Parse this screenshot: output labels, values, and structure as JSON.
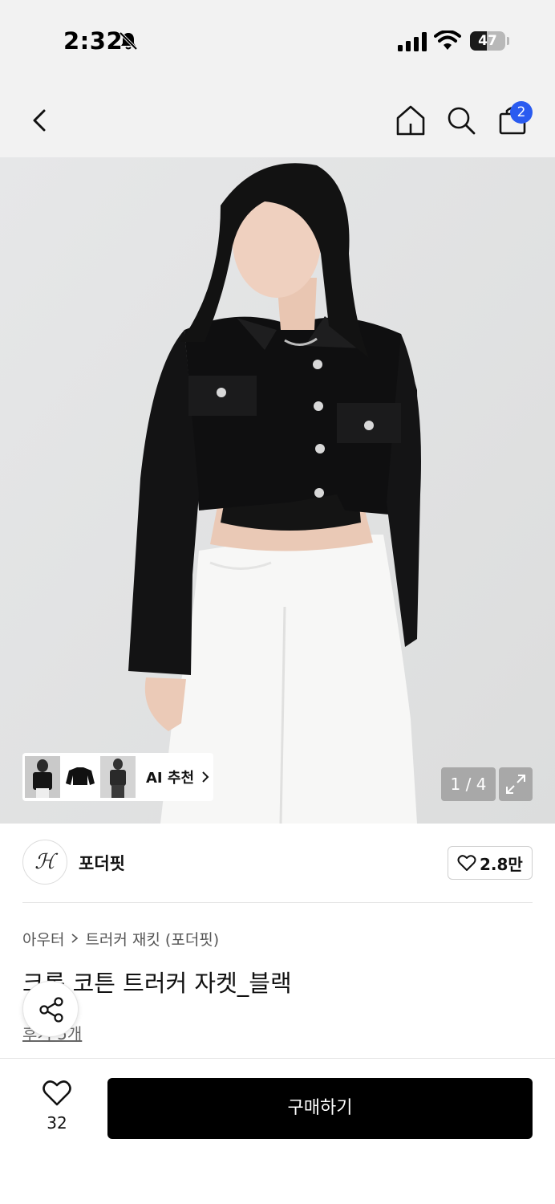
{
  "status_bar": {
    "time": "2:32",
    "battery_percent": 47,
    "battery_label": "47"
  },
  "nav": {
    "cart_count": "2",
    "icons": [
      "back-arrow-icon",
      "home-icon",
      "search-icon",
      "cart-icon"
    ]
  },
  "gallery": {
    "ai_recommend_label": "AI 추천",
    "counter": "1 / 4"
  },
  "brand": {
    "logo_text": "ℋ",
    "name": "포더핏",
    "like_count": "2.8만"
  },
  "product": {
    "breadcrumb": [
      "아우터",
      "트러커 재킷 (포더핏)"
    ],
    "title": "크롭 코튼 트러커 자켓_블랙",
    "review_link": "후기 5개"
  },
  "bottom_bar": {
    "wish_count": "32",
    "buy_label": "구매하기"
  },
  "colors": {
    "accent_badge": "#2a5bf0",
    "buy_button": "#000000",
    "header_bg": "#f2f2f2"
  }
}
